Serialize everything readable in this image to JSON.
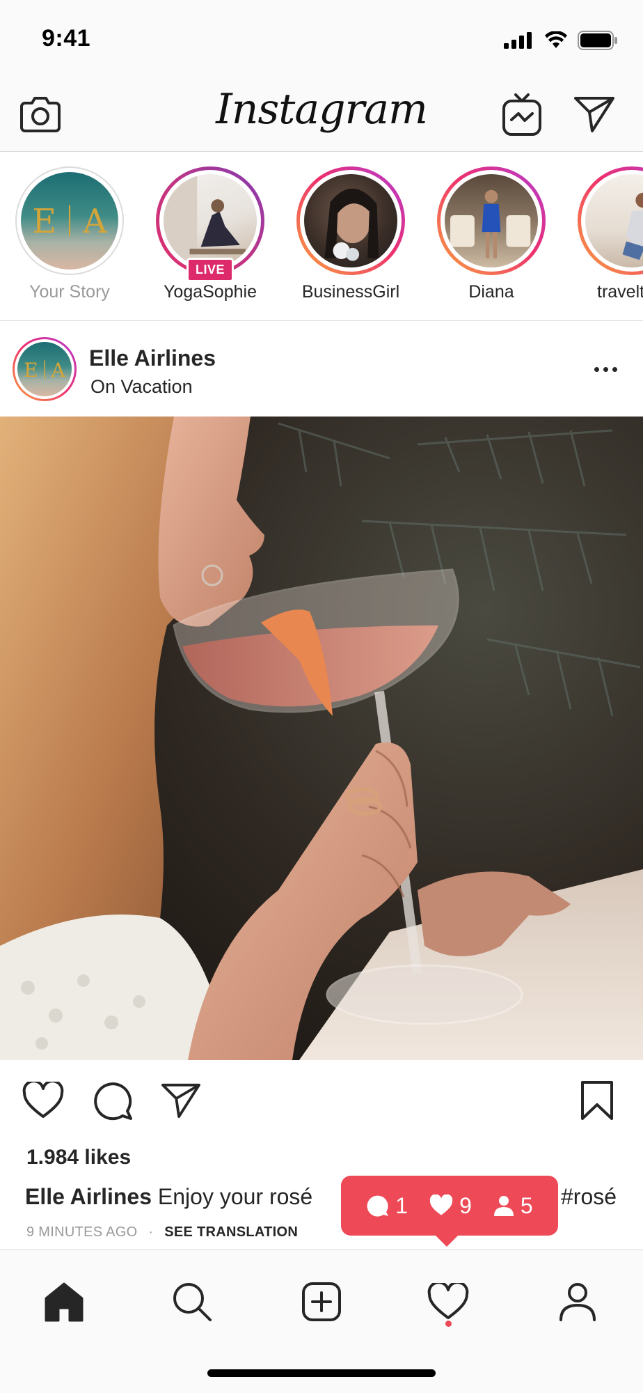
{
  "status_bar": {
    "time": "9:41"
  },
  "header": {
    "logo_text": "Instagram"
  },
  "stories": [
    {
      "name": "Your Story",
      "live": false,
      "seen": true
    },
    {
      "name": "YogaSophie",
      "live": true,
      "live_label": "LIVE"
    },
    {
      "name": "BusinessGirl",
      "live": false
    },
    {
      "name": "Diana",
      "live": false
    },
    {
      "name": "travelt",
      "live": false
    }
  ],
  "story_logo_letters": [
    "E",
    "A"
  ],
  "post": {
    "username": "Elle Airlines",
    "location": "On Vacation",
    "likes": "1.984 likes",
    "caption_user": "Elle Airlines",
    "caption_text": "Enjoy your rosé",
    "caption_tail": "#rosé",
    "time_ago": "9 MINUTES AGO",
    "separator": "·",
    "see_translation": "SEE TRANSLATION"
  },
  "notification": {
    "comments": "1",
    "likes": "9",
    "follows": "5"
  },
  "colors": {
    "accent_red": "#ed4956",
    "live_pink": "#dc2a6a",
    "border": "#dbdbdb"
  },
  "icons": {
    "camera": "camera-icon",
    "igtv": "igtv-icon",
    "direct": "direct-message-icon",
    "like": "heart-icon",
    "comment": "comment-icon",
    "share": "share-icon",
    "save": "bookmark-icon",
    "home": "home-icon",
    "search": "search-icon",
    "add": "add-post-icon",
    "activity": "activity-heart-icon",
    "profile": "profile-icon"
  }
}
